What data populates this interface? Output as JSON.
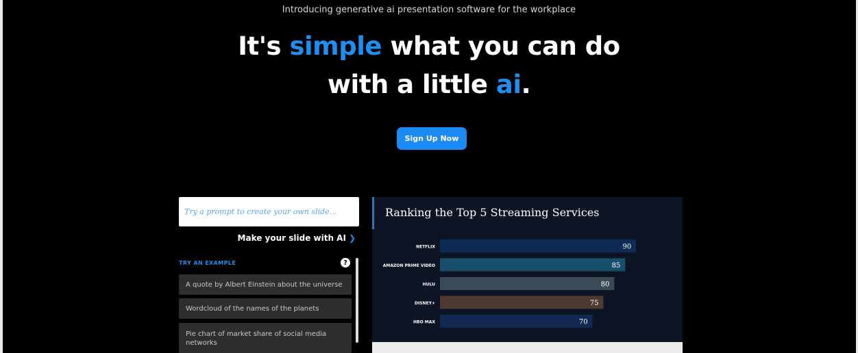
{
  "hero": {
    "intro": "Introducing generative ai presentation software for the workplace",
    "title_part1": "It's ",
    "title_highlight1": "simple",
    "title_part2": " what you can do",
    "title_part3": "with a little ",
    "title_highlight2": "ai",
    "title_part4": ".",
    "signup_label": "Sign Up Now"
  },
  "prompt": {
    "placeholder": "Try a prompt to create your own slide...",
    "make_slide_label": "Make your slide with AI",
    "make_slide_icon": "chevron-right-icon"
  },
  "examples": {
    "heading": "TRY AN EXAMPLE",
    "help_icon": "?",
    "items": [
      "A quote by Albert Einstein about the universe",
      "Wordcloud of the names of the planets",
      "Pie chart of market share of social media networks"
    ]
  },
  "slide": {
    "title": "Ranking the Top 5 Streaming Services"
  },
  "colors": {
    "accent": "#1f8ef1",
    "background": "#000000",
    "slide_background": "#0d1524"
  },
  "chart_data": {
    "type": "bar",
    "orientation": "horizontal",
    "title": "Ranking the Top 5 Streaming Services",
    "categories": [
      "NETFLIX",
      "AMAZON PRIME VIDEO",
      "HULU",
      "DISNEY+",
      "HBO MAX"
    ],
    "values": [
      90,
      85,
      80,
      75,
      70
    ],
    "colors": [
      "#0f2a55",
      "#1a4f6b",
      "#3b4b55",
      "#4e3a33",
      "#112a53"
    ],
    "xlim": [
      0,
      100
    ],
    "grid": false,
    "legend": "none"
  }
}
